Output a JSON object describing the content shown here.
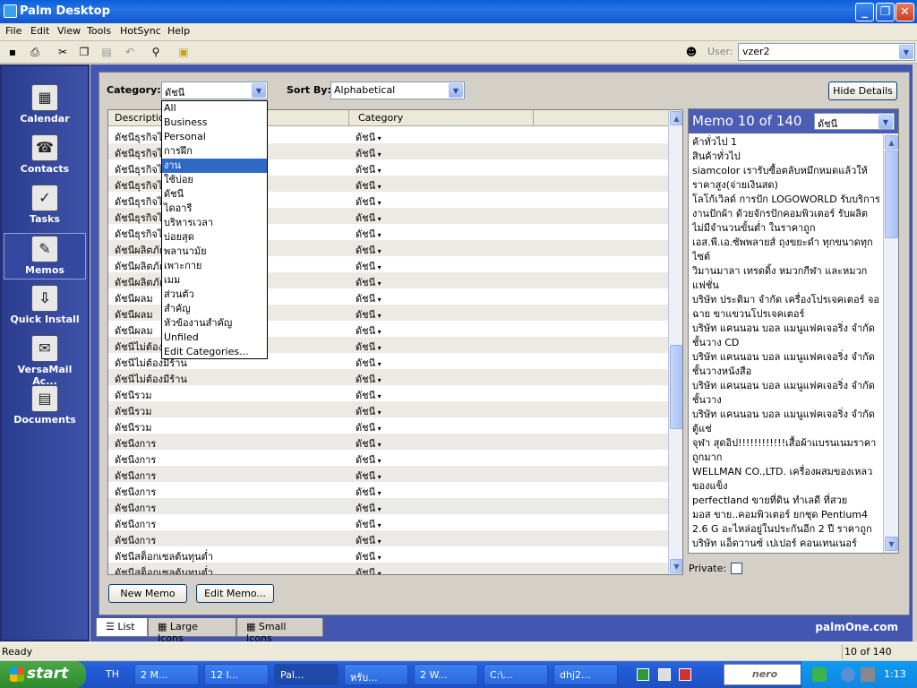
{
  "window": {
    "title": "Palm Desktop",
    "min": "_",
    "max": "❐",
    "close": "✕"
  },
  "menu": [
    "File",
    "Edit",
    "View",
    "Tools",
    "HotSync",
    "Help"
  ],
  "toolbar": {
    "user_label": "User:",
    "user_value": "vzer2"
  },
  "launcher": [
    {
      "label": "Calendar",
      "icon": "calendar-icon"
    },
    {
      "label": "Contacts",
      "icon": "contacts-icon"
    },
    {
      "label": "Tasks",
      "icon": "tasks-icon"
    },
    {
      "label": "Memos",
      "icon": "memos-icon",
      "selected": true
    },
    {
      "label": "Quick Install",
      "icon": "quick-install-icon"
    },
    {
      "label": "VersaMail Ac...",
      "icon": "versamail-icon"
    },
    {
      "label": "Documents",
      "icon": "documents-icon"
    }
  ],
  "filters": {
    "category_label": "Category:",
    "category_value": "ดัชนี",
    "sortby_label": "Sort By:",
    "sortby_value": "Alphabetical",
    "hide_details": "Hide Details"
  },
  "list": {
    "headers": {
      "description": "Description",
      "category": "Category"
    },
    "rows": [
      {
        "d": "ดัชนีธุรกิจไป",
        "c": "ดัชนี"
      },
      {
        "d": "ดัชนีธุรกิจไป",
        "c": "ดัชนี"
      },
      {
        "d": "ดัชนีธุรกิจไป",
        "c": "ดัชนี"
      },
      {
        "d": "ดัชนีธุรกิจไป",
        "c": "ดัชนี"
      },
      {
        "d": "ดัชนีธุรกิจไป",
        "c": "ดัชนี"
      },
      {
        "d": "ดัชนีธุรกิจไป",
        "c": "ดัชนี"
      },
      {
        "d": "ดัชนีธุรกิจไป",
        "c": "ดัชนี"
      },
      {
        "d": "ดัชนีผลิตภัณ",
        "c": "ดัชนี"
      },
      {
        "d": "ดัชนีผลิตภัณ",
        "c": "ดัชนี"
      },
      {
        "d": "ดัชนีผลิตภัณ",
        "c": "ดัชนี"
      },
      {
        "d": "ดัชนีผลม",
        "c": "ดัชนี"
      },
      {
        "d": "ดัชนีผลม",
        "c": "ดัชนี"
      },
      {
        "d": "ดัชนีผลม",
        "c": "ดัชนี"
      },
      {
        "d": "ดัชนีไม่ต้อง",
        "c": "ดัชนี"
      },
      {
        "d": "ดัชนีไม่ต้องมีร้าน",
        "c": "ดัชนี"
      },
      {
        "d": "ดัชนีไม่ต้องมีร้าน",
        "c": "ดัชนี"
      },
      {
        "d": "ดัชนีรวม",
        "c": "ดัชนี"
      },
      {
        "d": "ดัชนีรวม",
        "c": "ดัชนี"
      },
      {
        "d": "ดัชนีรวม",
        "c": "ดัชนี"
      },
      {
        "d": "ดัชนีงการ",
        "c": "ดัชนี"
      },
      {
        "d": "ดัชนีงการ",
        "c": "ดัชนี"
      },
      {
        "d": "ดัชนีงการ",
        "c": "ดัชนี"
      },
      {
        "d": "ดัชนีงการ",
        "c": "ดัชนี"
      },
      {
        "d": "ดัชนีงการ",
        "c": "ดัชนี"
      },
      {
        "d": "ดัชนีงการ",
        "c": "ดัชนี"
      },
      {
        "d": "ดัชนีงการ",
        "c": "ดัชนี"
      },
      {
        "d": "ดัชนีสต็อกเซลต้นทุนต่ำ",
        "c": "ดัชนี"
      },
      {
        "d": "ดัชนีสต็อกเซลต้นทุนต่ำ",
        "c": "ดัชนี"
      }
    ]
  },
  "dropdown": {
    "items": [
      "All",
      "Business",
      "Personal",
      "การฝึก",
      "งาน",
      "ใช้บ่อย",
      "ดัชนี",
      "ไดอารี",
      "บริหารเวลา",
      "บ่อยสุด",
      "พลานามัย",
      "เพาะกาย",
      "เมม",
      "ส่วนตัว",
      "สำคัญ",
      "หัวข้องานสำคัญ",
      "Unfiled",
      "Edit Categories..."
    ],
    "highlighted_index": 4
  },
  "memo": {
    "title": "Memo 10 of 140",
    "category": "ดัชนี",
    "lines": [
      "ค้าทั่วไป 1",
      "สินค้าทั่วไป",
      "siamcolor เรารับซื้อตลับหมึกหมดแล้วให้ราคาสูง(จ่ายเงินสด)",
      "โลโก้เวิลด์ การปัก LOGOWORLD รับบริการงานปักผ้า ด้วยจักรปักคอมพิวเตอร์ รับผลิตไม่มีจำนวนขั้นต่ำ ในราคาถูก",
      "เอส.พี.เอ.ซัพพลายส์ ถุงขยะดำ ทุกขนาดทุกไซต์",
      "วิมานมาลา เทรดดิ้ง หมวกกีฬา และหมวกแฟชั่น",
      "บริษัท ประติมา จำกัด เครื่องโปรเจคเตอร์ จอฉาย ขาแขวนโปรเจคเตอร์",
      "บริษัท แคนนอน บอล แมนูแฟคเจอริ่ง จำกัด ชั้นวาง CD",
      "บริษัท แคนนอน บอล แมนูแฟคเจอริ่ง จำกัด ชั้นวางหนังสือ",
      "บริษัท แคนนอน บอล แมนูแฟคเจอริ่ง จำกัด ชั้นวาง",
      "บริษัท แคนนอน บอล แมนูแฟคเจอริ่ง จำกัด ตู้แช่",
      "จุฬา สุดอิป!!!!!!!!!!!!เสื้อผ้าแบรนเนมราคาถูกมาก",
      "WELLMAN CO.,LTD. เครื่องผสมของเหลว ของแข็ง",
      "perfectland ขายที่ดิน ทำเลดี ที่สวย",
      "มอส ขาย..คอมพิวเตอร์ ยกชุด Pentium4 2.6 G อะไหล่อยู่ในประกันอีก 2 ปี ราคาถูก",
      "บริษัท แอ็ดวานซ์ เปเปอร์ คอนเทนเนอร์ จำกัด"
    ],
    "private_label": "Private:"
  },
  "buttons": {
    "new_memo": "New Memo",
    "edit_memo": "Edit Memo..."
  },
  "tabs": [
    "List",
    "Large Icons",
    "Small Icons"
  ],
  "brand": "palmOne.com",
  "status": {
    "left": "Ready",
    "right": "10 of 140"
  },
  "taskbar": {
    "start": "start",
    "lang": "TH",
    "tasks": [
      "2 M...",
      "12 I...",
      "Pal...",
      "หรับ...",
      "2 W...",
      "C:\\...",
      "dhj2..."
    ],
    "clock": "1:13",
    "nero": "nero"
  }
}
